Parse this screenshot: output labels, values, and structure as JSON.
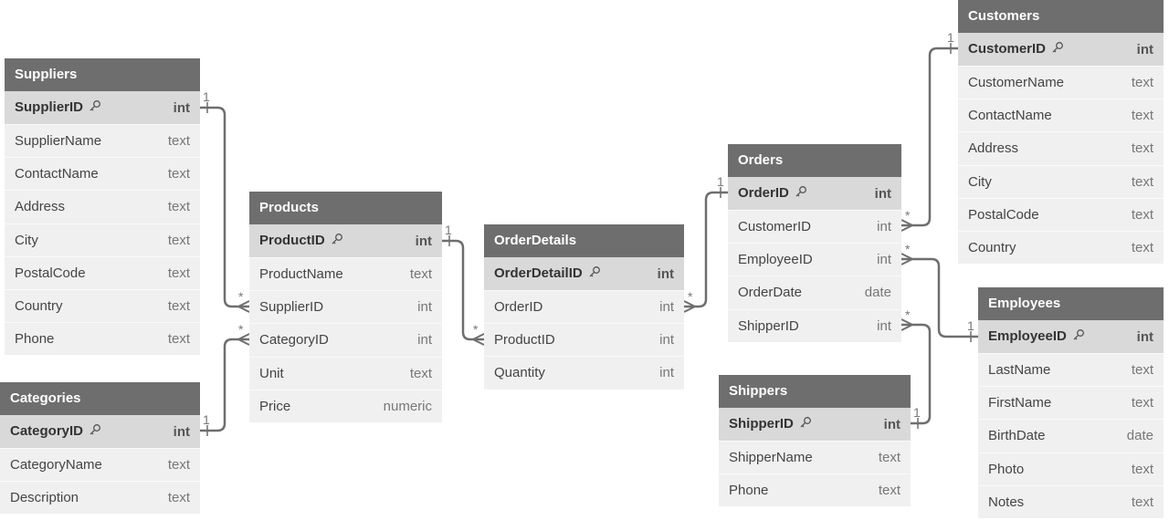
{
  "tables": [
    {
      "id": "suppliers",
      "name": "Suppliers",
      "columns": [
        {
          "name": "SupplierID",
          "type": "int",
          "pk": true
        },
        {
          "name": "SupplierName",
          "type": "text"
        },
        {
          "name": "ContactName",
          "type": "text"
        },
        {
          "name": "Address",
          "type": "text"
        },
        {
          "name": "City",
          "type": "text"
        },
        {
          "name": "PostalCode",
          "type": "text"
        },
        {
          "name": "Country",
          "type": "text"
        },
        {
          "name": "Phone",
          "type": "text"
        }
      ]
    },
    {
      "id": "categories",
      "name": "Categories",
      "columns": [
        {
          "name": "CategoryID",
          "type": "int",
          "pk": true
        },
        {
          "name": "CategoryName",
          "type": "text"
        },
        {
          "name": "Description",
          "type": "text"
        }
      ]
    },
    {
      "id": "products",
      "name": "Products",
      "columns": [
        {
          "name": "ProductID",
          "type": "int",
          "pk": true
        },
        {
          "name": "ProductName",
          "type": "text"
        },
        {
          "name": "SupplierID",
          "type": "int"
        },
        {
          "name": "CategoryID",
          "type": "int"
        },
        {
          "name": "Unit",
          "type": "text"
        },
        {
          "name": "Price",
          "type": "numeric"
        }
      ]
    },
    {
      "id": "orderdetails",
      "name": "OrderDetails",
      "columns": [
        {
          "name": "OrderDetailID",
          "type": "int",
          "pk": true
        },
        {
          "name": "OrderID",
          "type": "int"
        },
        {
          "name": "ProductID",
          "type": "int"
        },
        {
          "name": "Quantity",
          "type": "int"
        }
      ]
    },
    {
      "id": "orders",
      "name": "Orders",
      "columns": [
        {
          "name": "OrderID",
          "type": "int",
          "pk": true
        },
        {
          "name": "CustomerID",
          "type": "int"
        },
        {
          "name": "EmployeeID",
          "type": "int"
        },
        {
          "name": "OrderDate",
          "type": "date"
        },
        {
          "name": "ShipperID",
          "type": "int"
        }
      ]
    },
    {
      "id": "shippers",
      "name": "Shippers",
      "columns": [
        {
          "name": "ShipperID",
          "type": "int",
          "pk": true
        },
        {
          "name": "ShipperName",
          "type": "text"
        },
        {
          "name": "Phone",
          "type": "text"
        }
      ]
    },
    {
      "id": "customers",
      "name": "Customers",
      "columns": [
        {
          "name": "CustomerID",
          "type": "int",
          "pk": true
        },
        {
          "name": "CustomerName",
          "type": "text"
        },
        {
          "name": "ContactName",
          "type": "text"
        },
        {
          "name": "Address",
          "type": "text"
        },
        {
          "name": "City",
          "type": "text"
        },
        {
          "name": "PostalCode",
          "type": "text"
        },
        {
          "name": "Country",
          "type": "text"
        }
      ]
    },
    {
      "id": "employees",
      "name": "Employees",
      "columns": [
        {
          "name": "EmployeeID",
          "type": "int",
          "pk": true
        },
        {
          "name": "LastName",
          "type": "text"
        },
        {
          "name": "FirstName",
          "type": "text"
        },
        {
          "name": "BirthDate",
          "type": "date"
        },
        {
          "name": "Photo",
          "type": "text"
        },
        {
          "name": "Notes",
          "type": "text"
        }
      ]
    }
  ],
  "relationships": [
    {
      "from": "Suppliers.SupplierID",
      "to": "Products.SupplierID",
      "from_card": "1",
      "to_card": "*"
    },
    {
      "from": "Categories.CategoryID",
      "to": "Products.CategoryID",
      "from_card": "1",
      "to_card": "*"
    },
    {
      "from": "Products.ProductID",
      "to": "OrderDetails.ProductID",
      "from_card": "1",
      "to_card": "*"
    },
    {
      "from": "Orders.OrderID",
      "to": "OrderDetails.OrderID",
      "from_card": "1",
      "to_card": "*"
    },
    {
      "from": "Customers.CustomerID",
      "to": "Orders.CustomerID",
      "from_card": "1",
      "to_card": "*"
    },
    {
      "from": "Employees.EmployeeID",
      "to": "Orders.EmployeeID",
      "from_card": "1",
      "to_card": "*"
    },
    {
      "from": "Shippers.ShipperID",
      "to": "Orders.ShipperID",
      "from_card": "1",
      "to_card": "*"
    }
  ],
  "colors": {
    "header": "#6e6e6e",
    "pk_row": "#d9d9d9",
    "row": "#f0f0f0",
    "line": "#6e6e6e"
  }
}
